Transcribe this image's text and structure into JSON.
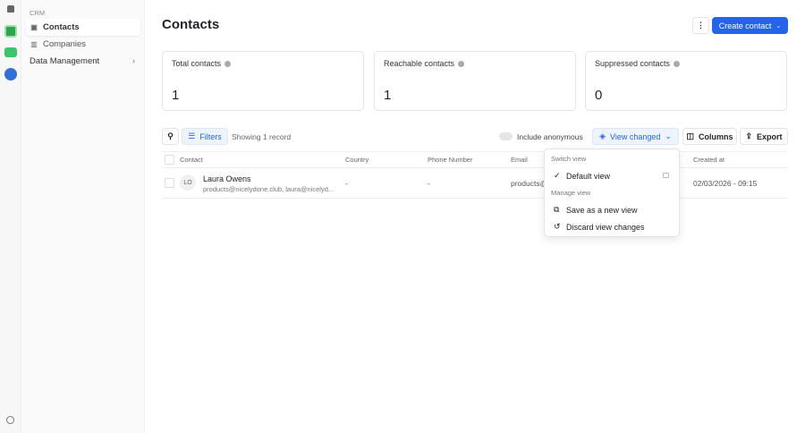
{
  "sidebar": {
    "section": "CRM",
    "items": [
      {
        "label": "Contacts"
      },
      {
        "label": "Companies"
      },
      {
        "label": "Data Management"
      }
    ]
  },
  "header": {
    "title": "Contacts",
    "create_label": "Create contact"
  },
  "stats": [
    {
      "label": "Total contacts",
      "value": "1"
    },
    {
      "label": "Reachable contacts",
      "value": "1"
    },
    {
      "label": "Suppressed contacts",
      "value": "0"
    }
  ],
  "toolbar": {
    "filters": "Filters",
    "showing": "Showing 1 record",
    "include_anonymous": "Include anonymous",
    "view": "View changed",
    "columns": "Columns",
    "export": "Export"
  },
  "table": {
    "headers": [
      "Contact",
      "Country",
      "Phone Number",
      "Email",
      "Created at"
    ],
    "rows": [
      {
        "initials": "LO",
        "name": "Laura Owens",
        "emails": "products@nicelydone.club, laura@nicelyd...",
        "country": "-",
        "phone": "-",
        "email": "products@",
        "created": "02/03/2026 - 09:15"
      }
    ]
  },
  "dropdown": {
    "switch_header": "Switch view",
    "default_view": "Default view",
    "manage_header": "Manage view",
    "save_new": "Save as a new view",
    "discard": "Discard view changes"
  },
  "colors": {
    "accent": "#2563eb"
  }
}
